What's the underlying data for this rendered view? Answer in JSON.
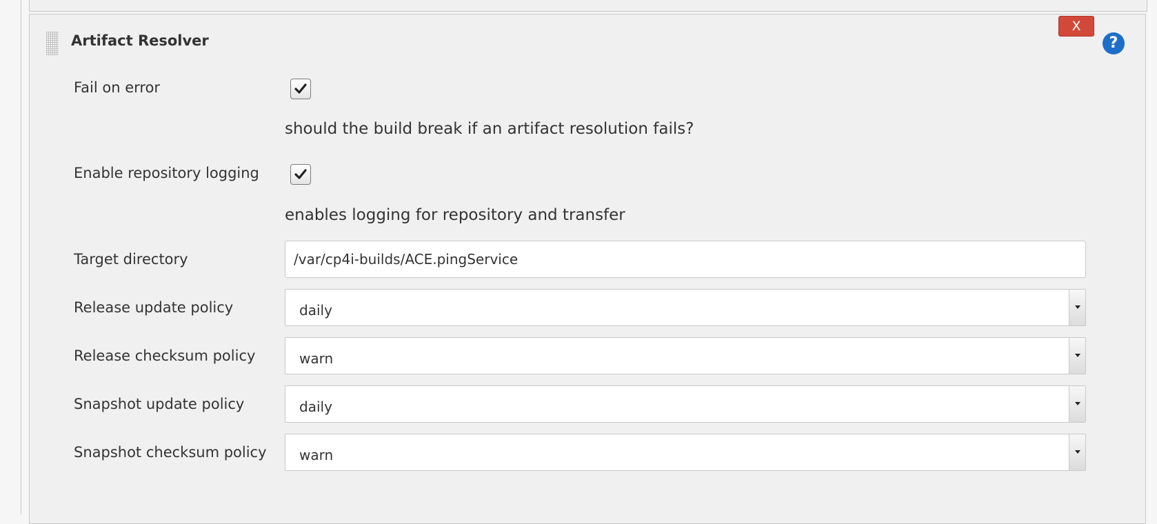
{
  "panel": {
    "title": "Artifact Resolver",
    "delete_label": "X",
    "help_glyph": "?"
  },
  "fields": {
    "fail_on_error": {
      "label": "Fail on error",
      "checked": true,
      "help": "should the build break if an artifact resolution fails?"
    },
    "repo_logging": {
      "label": "Enable repository logging",
      "checked": true,
      "help": "enables logging for repository and transfer"
    },
    "target_directory": {
      "label": "Target directory",
      "value": "/var/cp4i-builds/ACE.pingService"
    },
    "release_update_policy": {
      "label": "Release update policy",
      "value": "daily"
    },
    "release_checksum_policy": {
      "label": "Release checksum policy",
      "value": "warn"
    },
    "snapshot_update_policy": {
      "label": "Snapshot update policy",
      "value": "daily"
    },
    "snapshot_checksum_policy": {
      "label": "Snapshot checksum policy",
      "value": "warn"
    }
  },
  "colors": {
    "delete_button": "#d24939",
    "help_icon": "#1d6ec8",
    "panel_bg": "#f0f0f0"
  }
}
